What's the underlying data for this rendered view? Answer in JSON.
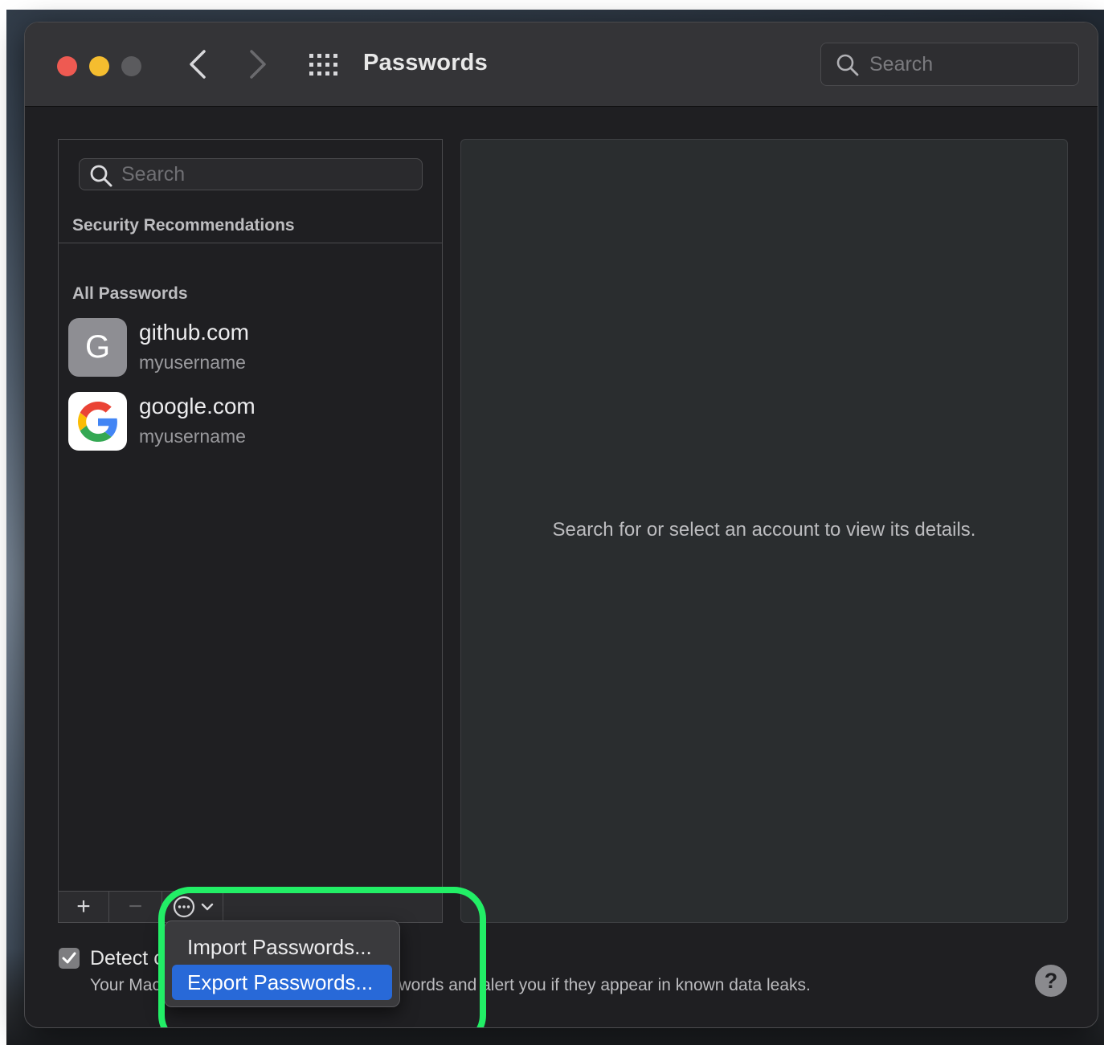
{
  "window": {
    "title": "Passwords",
    "search_placeholder": "Search"
  },
  "list": {
    "search_placeholder": "Search",
    "security_label": "Security Recommendations",
    "all_label": "All Passwords",
    "items": [
      {
        "site": "github.com",
        "username": "myusername",
        "icon": "letter-g-icon",
        "letter": "G"
      },
      {
        "site": "google.com",
        "username": "myusername",
        "icon": "google-logo-icon"
      }
    ]
  },
  "toolbar": {
    "add_glyph": "+",
    "remove_glyph": "−"
  },
  "detail": {
    "empty_message": "Search for or select an account to view its details."
  },
  "detect": {
    "title": "Detect compromised passwords",
    "description": "Your Mac can securely monitor your passwords and alert you if they appear in known data leaks.",
    "checked": true
  },
  "help": {
    "label": "?"
  },
  "menu": {
    "import_label": "Import Passwords...",
    "export_label": "Export Passwords..."
  },
  "colors": {
    "accent": "#2869d8",
    "highlight": "#22ee66",
    "close": "#ee5a52",
    "minimize": "#f5bd2f"
  }
}
